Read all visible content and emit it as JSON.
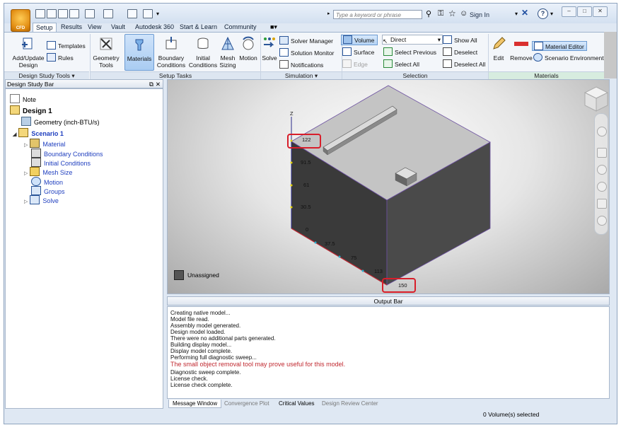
{
  "title_bar": {
    "app_button": "CFD",
    "search_placeholder": "Type a keyword or phrase",
    "sign_in": "Sign In",
    "help": "?",
    "window_controls": [
      "–",
      "□",
      "✕"
    ]
  },
  "tabs": [
    "Setup",
    "Results",
    "View",
    "Vault",
    "Autodesk 360",
    "Start & Learn",
    "Community"
  ],
  "ribbon": {
    "design_study_tools": {
      "label": "Design Study Tools ▾",
      "add_update": "Add/Update\nDesign",
      "templates": "Templates",
      "rules": "Rules"
    },
    "setup_tasks": {
      "label": "Setup Tasks",
      "items": [
        "Geometry\nTools",
        "Materials",
        "Boundary\nConditions",
        "Initial\nConditions",
        "Mesh\nSizing",
        "Motion"
      ]
    },
    "simulation": {
      "label": "Simulation ▾",
      "solve": "Solve",
      "solver_manager": "Solver Manager",
      "solution_monitor": "Solution Monitor",
      "notifications": "Notifications"
    },
    "selection": {
      "label": "Selection",
      "volume": "Volume",
      "surface": "Surface",
      "edge": "Edge",
      "direct": "Direct",
      "select_previous": "Select Previous",
      "select_all": "Select All",
      "show_all": "Show All",
      "deselect": "Deselect",
      "deselect_all": "Deselect All"
    },
    "materials": {
      "label": "Materials",
      "edit": "Edit",
      "remove": "Remove",
      "material_editor": "Material Editor",
      "scenario_environment": "Scenario Environment"
    }
  },
  "design_study_bar": {
    "title": "Design Study Bar",
    "items": [
      {
        "label": "Note"
      },
      {
        "label": "Design 1"
      },
      {
        "label": "Geometry (inch-BTU/s)"
      },
      {
        "label": "Scenario 1"
      },
      {
        "label": "Material"
      },
      {
        "label": "Boundary Conditions"
      },
      {
        "label": "Initial Conditions"
      },
      {
        "label": "Mesh Size"
      },
      {
        "label": "Motion"
      },
      {
        "label": "Groups"
      },
      {
        "label": "Solve"
      }
    ]
  },
  "viewport": {
    "z_axis_label": "Z",
    "z_ticks": [
      "122",
      "91.5",
      "61",
      "30.5",
      "0"
    ],
    "x_ticks": [
      "37.5",
      "75",
      "113",
      "150"
    ],
    "legend_label": "Unassigned",
    "colors": {
      "box_front": "#3c3c3c",
      "box_top": "#c4c4c4",
      "highlight": "#d81e2a"
    }
  },
  "output_bar": {
    "title": "Output Bar",
    "lines": [
      "Creating native model...",
      "Model file read.",
      "Assembly model generated.",
      "Design model loaded.",
      "There were no additional parts generated.",
      "Building display model...",
      "Display model complete.",
      "Performing full diagnostic sweep...",
      "The small object removal tool may prove useful for this model.",
      "Diagnostic sweep complete.",
      "License check.",
      "License check complete."
    ],
    "tabs": [
      "Message Window",
      "Convergence Plot",
      "Critical Values",
      "Design Review Center"
    ]
  },
  "status_bar": {
    "text": "0 Volume(s) selected"
  }
}
